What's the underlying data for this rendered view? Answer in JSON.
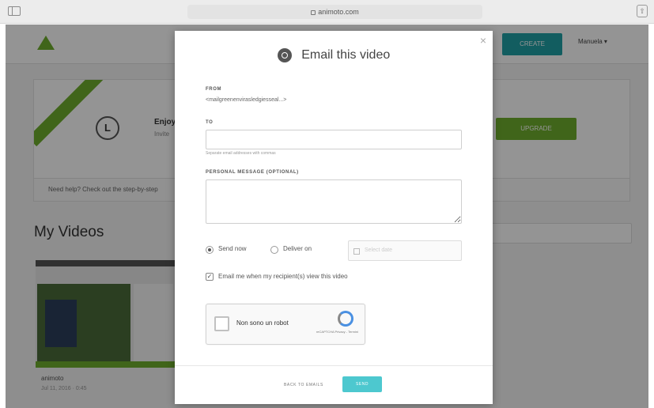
{
  "browser": {
    "url": "animoto.com"
  },
  "page": {
    "nav_cta": "CREATE",
    "user_menu": "Manuela ▾",
    "promo_title": "Enjoy",
    "promo_subtitle": "Invite",
    "promo_button": "UPGRADE",
    "info_strip": "Need help? Check out the step-by-step",
    "section_title": "My Videos",
    "video_name": "animoto",
    "video_meta": "Jul 11, 2016 · 0:45"
  },
  "modal": {
    "title": "Email this video",
    "close_glyph": "×",
    "from_label": "FROM",
    "from_value": "<mailgreenenvirasledgiesseal...>",
    "to_label": "TO",
    "to_help": "Separate email addresses with commas",
    "message_label": "PERSONAL MESSAGE (OPTIONAL)",
    "send_now_label": "Send now",
    "deliver_on_label": "Deliver on",
    "date_placeholder": "Select date",
    "notify_checkbox_glyph": "✓",
    "notify_label": "Email me when my recipient(s) view this video",
    "captcha_label": "Non sono un robot",
    "captcha_brand": "reCAPTCHA\nPrivacy - Termini",
    "back_link": "BACK TO EMAILS",
    "send_button": "SEND"
  }
}
